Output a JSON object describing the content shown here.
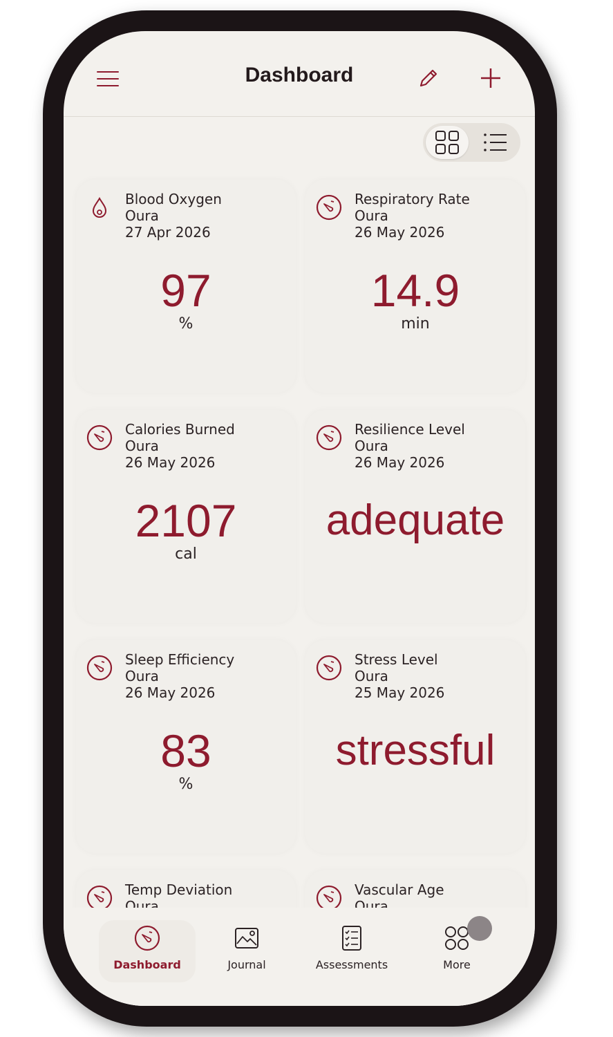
{
  "header": {
    "title": "Dashboard",
    "menu_icon": "hamburger-menu-icon",
    "edit_icon": "pencil-icon",
    "add_icon": "plus-icon"
  },
  "view_toggle": {
    "selected": "grid",
    "options": [
      "grid",
      "list"
    ]
  },
  "cards": [
    {
      "name": "Blood Oxygen",
      "source": "Oura",
      "date": "27 Apr 2026",
      "value": "97",
      "unit": "%",
      "icon": "drop-icon"
    },
    {
      "name": "Respiratory Rate",
      "source": "Oura",
      "date": "26 May 2026",
      "value": "14.9",
      "unit": "min",
      "icon": "gauge-icon"
    },
    {
      "name": "Calories Burned",
      "source": "Oura",
      "date": "26 May 2026",
      "value": "2107",
      "unit": "cal",
      "icon": "gauge-icon"
    },
    {
      "name": "Resilience Level",
      "source": "Oura",
      "date": "26 May 2026",
      "value": "adequate",
      "unit": "",
      "icon": "gauge-icon"
    },
    {
      "name": "Sleep Efficiency",
      "source": "Oura",
      "date": "26 May 2026",
      "value": "83",
      "unit": "%",
      "icon": "gauge-icon"
    },
    {
      "name": "Stress Level",
      "source": "Oura",
      "date": "25 May 2026",
      "value": "stressful",
      "unit": "",
      "icon": "gauge-icon"
    },
    {
      "name": "Temp Deviation",
      "source": "Oura",
      "date": "",
      "value": "",
      "unit": "",
      "icon": "gauge-icon"
    },
    {
      "name": "Vascular Age",
      "source": "Oura",
      "date": "",
      "value": "",
      "unit": "",
      "icon": "gauge-icon"
    }
  ],
  "nav": {
    "items": [
      {
        "label": "Dashboard",
        "icon": "gauge-icon",
        "active": true
      },
      {
        "label": "Journal",
        "icon": "image-icon",
        "active": false
      },
      {
        "label": "Assessments",
        "icon": "checklist-icon",
        "active": false
      },
      {
        "label": "More",
        "icon": "grid-circles-icon",
        "active": false
      }
    ]
  },
  "colors": {
    "accent": "#8e1b2e",
    "background": "#f3f1ed",
    "card": "#f1efeb",
    "text": "#2b2224",
    "frame": "#1b1416"
  }
}
